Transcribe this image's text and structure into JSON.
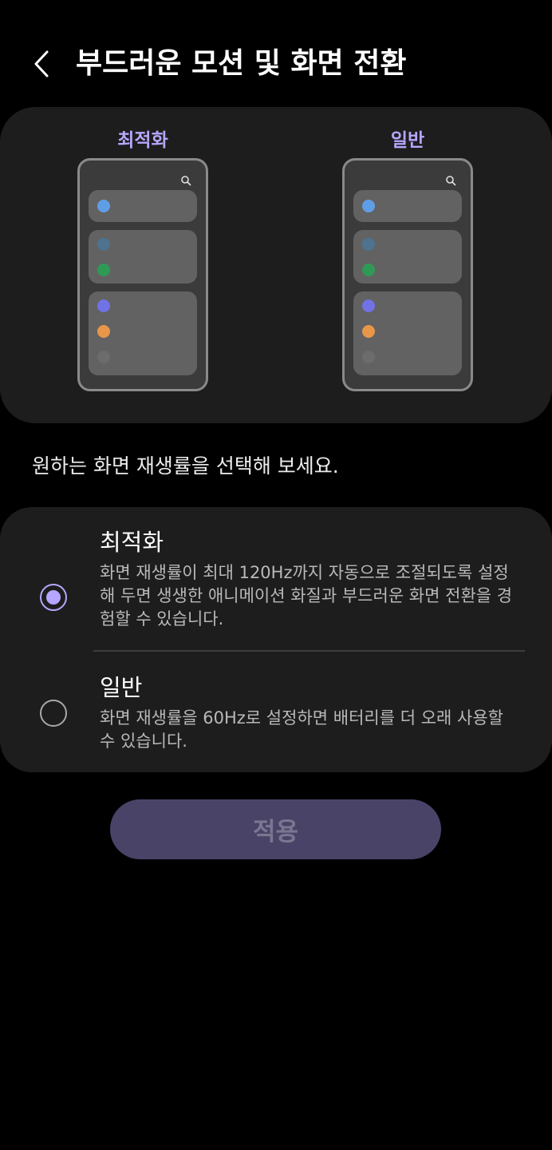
{
  "header": {
    "title": "부드러운 모션 및 화면 전환",
    "back_icon": "chevron-left-icon"
  },
  "preview": {
    "optimized_label": "최적화",
    "standard_label": "일반",
    "dot_colors": {
      "blue": "#5f9ee6",
      "slate": "#4e7390",
      "green": "#2e9a56",
      "purple": "#7172e6",
      "orange": "#e8974a",
      "gray": "#6c6c6c"
    }
  },
  "subtitle": "원하는 화면 재생률을 선택해 보세요.",
  "options": [
    {
      "title": "최적화",
      "description": "화면 재생률이 최대 120Hz까지 자동으로 조절되도록 설정해 두면 생생한 애니메이션 화질과 부드러운 화면 전환을 경험할 수 있습니다.",
      "selected": true
    },
    {
      "title": "일반",
      "description": "화면 재생률을 60Hz로 설정하면 배터리를 더 오래 사용할 수 있습니다.",
      "selected": false
    }
  ],
  "apply_button": {
    "label": "적용"
  },
  "colors": {
    "accent": "#b7a6ff",
    "card_bg": "#1d1d1d",
    "button_bg": "#4a4368"
  }
}
